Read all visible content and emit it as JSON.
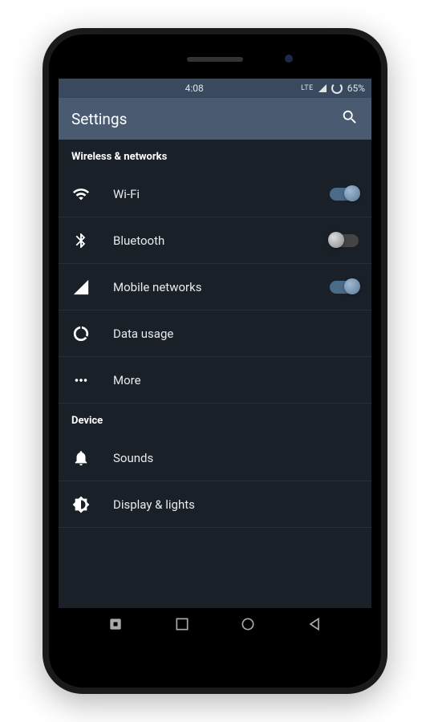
{
  "statusBar": {
    "time": "4:08",
    "network": "LTE",
    "battery": "65%"
  },
  "appBar": {
    "title": "Settings"
  },
  "sections": {
    "wireless": {
      "header": "Wireless & networks",
      "wifi": "Wi-Fi",
      "bluetooth": "Bluetooth",
      "mobile": "Mobile networks",
      "data": "Data usage",
      "more": "More"
    },
    "device": {
      "header": "Device",
      "sounds": "Sounds",
      "display": "Display & lights"
    }
  },
  "toggles": {
    "wifi": true,
    "bluetooth": false,
    "mobile": true
  }
}
